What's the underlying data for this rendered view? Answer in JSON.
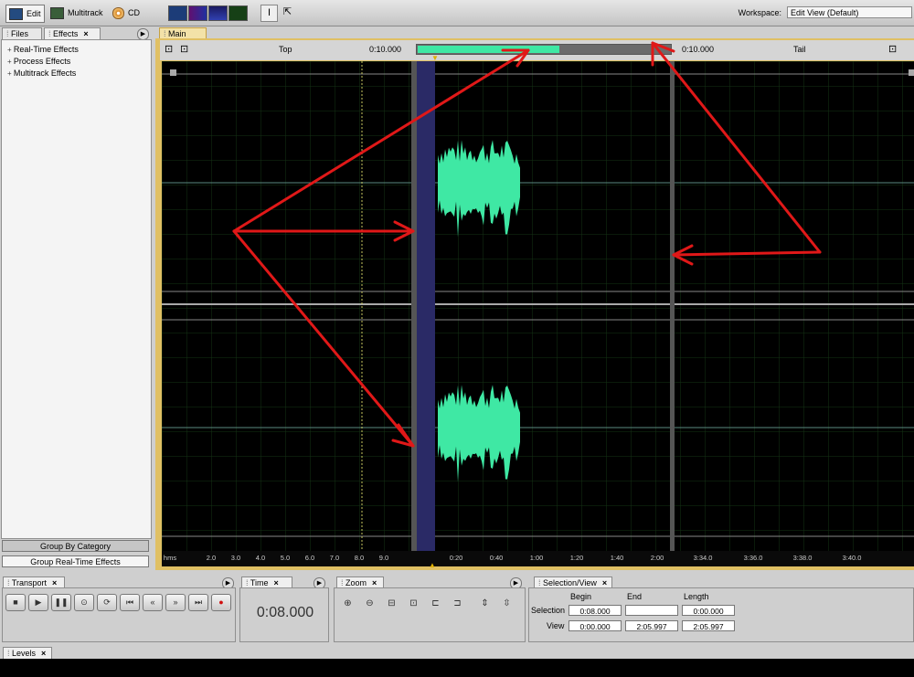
{
  "toolbar": {
    "edit_label": "Edit",
    "multitrack_label": "Multitrack",
    "cd_label": "CD",
    "workspace_label": "Workspace:",
    "workspace_value": "Edit View (Default)"
  },
  "left_panel": {
    "tabs": [
      {
        "label": "Files"
      },
      {
        "label": "Effects"
      }
    ],
    "tree": [
      {
        "label": "Real-Time Effects"
      },
      {
        "label": "Process Effects"
      },
      {
        "label": "Multitrack Effects"
      }
    ],
    "group_by_category": "Group By Category",
    "group_realtime": "Group Real-Time Effects"
  },
  "main": {
    "tab_label": "Main",
    "top_label": "Top",
    "top_time": "0:10.000",
    "tail_time": "0:10.000",
    "tail_label": "Tail",
    "ruler_format": "hms",
    "ruler_ticks": [
      "2.0",
      "3.0",
      "4.0",
      "5.0",
      "6.0",
      "7.0",
      "8.0",
      "9.0",
      "0:20",
      "0:40",
      "1:00",
      "1:20",
      "1:40",
      "2:00",
      "3:34.0",
      "3:36.0",
      "3:38.0",
      "3:40.0"
    ]
  },
  "transport": {
    "title": "Transport"
  },
  "time_panel": {
    "title": "Time",
    "value": "0:08.000"
  },
  "zoom_panel": {
    "title": "Zoom"
  },
  "selection_view": {
    "title": "Selection/View",
    "headers": {
      "begin": "Begin",
      "end": "End",
      "length": "Length"
    },
    "selection": {
      "label": "Selection",
      "begin": "0:08.000",
      "end": "",
      "length": "0:00.000"
    },
    "view": {
      "label": "View",
      "begin": "0:00.000",
      "end": "2:05.997",
      "length": "2:05.997"
    }
  },
  "levels": {
    "title": "Levels"
  },
  "colors": {
    "waveform": "#3fe8a4",
    "annotation": "#e01818",
    "selection": "#2a2a66"
  }
}
